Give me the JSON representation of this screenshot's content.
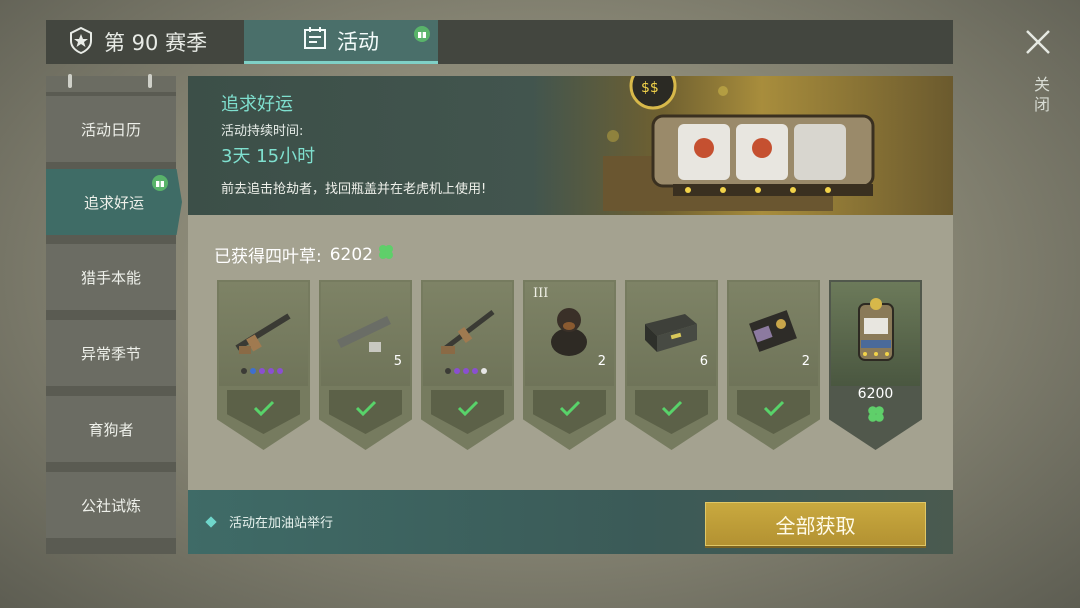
{
  "tabs": {
    "season_label": "第 90 赛季",
    "activity_label": "活动"
  },
  "close": {
    "label": "关闭"
  },
  "sidebar": {
    "items": [
      {
        "label": "活动日历"
      },
      {
        "label": "追求好运"
      },
      {
        "label": "猎手本能"
      },
      {
        "label": "异常季节"
      },
      {
        "label": "育狗者"
      },
      {
        "label": "公社试炼"
      }
    ],
    "active_index": 1
  },
  "banner": {
    "title": "追求好运",
    "duration_label": "活动持续时间:",
    "duration": "3天 15小时",
    "description": "前去追击抢劫者，找回瓶盖并在老虎机上使用!"
  },
  "clovers": {
    "label": "已获得四叶草:",
    "value": "6202"
  },
  "rewards": [
    {
      "icon": "rifle-icon",
      "qty": "",
      "tier": "",
      "dots": [
        "#3b3b36",
        "#3e6fcf",
        "#8a4fd0",
        "#8a4fd0",
        "#8a4fd0"
      ],
      "claimed": true
    },
    {
      "icon": "rocket-launcher-icon",
      "qty": "5",
      "tier": "",
      "dots": [],
      "claimed": true
    },
    {
      "icon": "assault-rifle-icon",
      "qty": "",
      "tier": "",
      "dots": [
        "#3b3b36",
        "#8a4fd0",
        "#8a4fd0",
        "#8a4fd0",
        "#e6e6e6"
      ],
      "claimed": true
    },
    {
      "icon": "dog-icon",
      "qty": "2",
      "tier": "III",
      "dots": [],
      "claimed": true
    },
    {
      "icon": "weapon-crate-icon",
      "qty": "6",
      "tier": "",
      "dots": [],
      "claimed": true
    },
    {
      "icon": "badge-wallet-icon",
      "qty": "2",
      "tier": "",
      "dots": [],
      "claimed": true
    }
  ],
  "final_reward": {
    "icon": "slot-machine-icon",
    "cost": "6200"
  },
  "footer": {
    "note": "活动在加油站举行",
    "claim_all": "全部获取"
  },
  "colors": {
    "accent_teal": "#7fe0cf",
    "clover_green": "#5fcf6a",
    "check_green": "#58d36a",
    "gold_button": "#c9a93f"
  }
}
